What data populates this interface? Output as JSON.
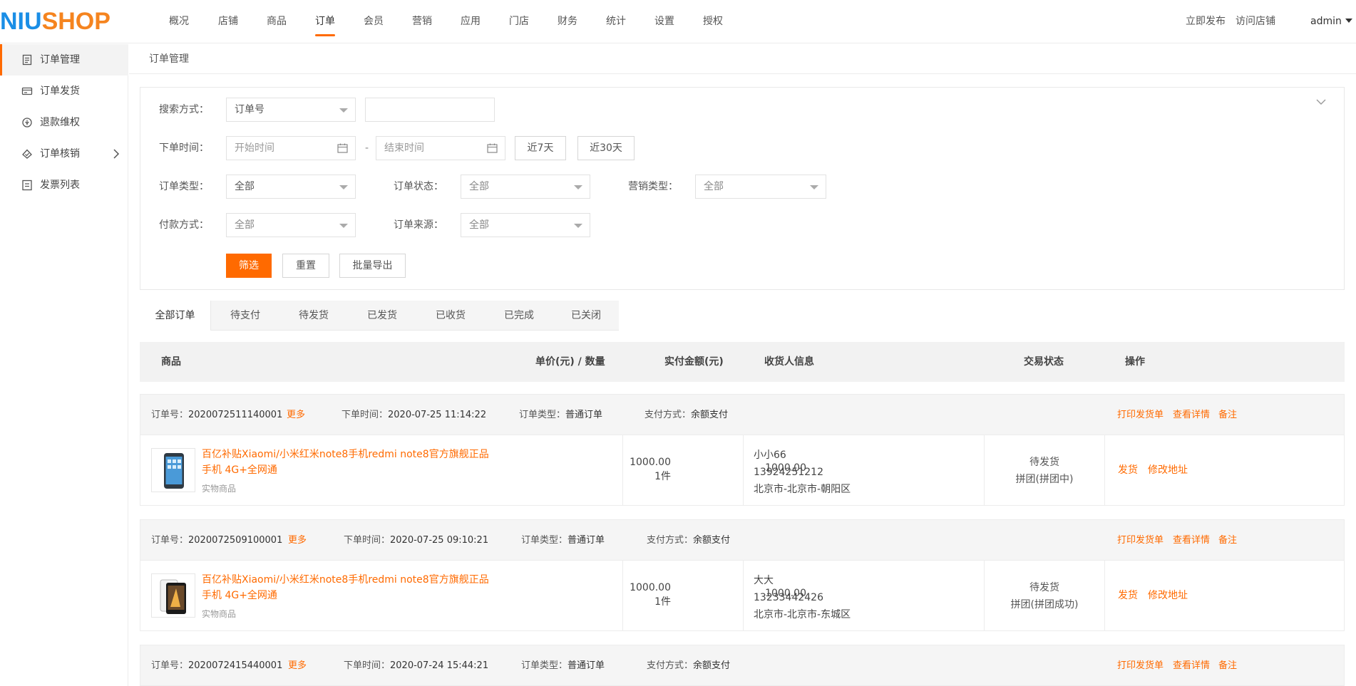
{
  "brand": {
    "logo_part1": "NIU",
    "logo_part2": "SHOP"
  },
  "nav": {
    "items": [
      "概况",
      "店铺",
      "商品",
      "订单",
      "会员",
      "营销",
      "应用",
      "门店",
      "财务",
      "统计",
      "设置",
      "授权"
    ],
    "active": "订单",
    "publish": "立即发布",
    "visit_store": "访问店铺",
    "user": "admin"
  },
  "sidebar": {
    "items": [
      {
        "label": "订单管理",
        "icon": "document-icon",
        "active": true
      },
      {
        "label": "订单发货",
        "icon": "delivery-icon",
        "active": false
      },
      {
        "label": "退款维权",
        "icon": "refund-icon",
        "active": false
      },
      {
        "label": "订单核销",
        "icon": "verify-icon",
        "active": false
      },
      {
        "label": "发票列表",
        "icon": "invoice-icon",
        "active": false
      }
    ]
  },
  "breadcrumb": "订单管理",
  "filter": {
    "search_label": "搜索方式：",
    "search_type": "订单号",
    "search_value": "",
    "time_label": "下单时间：",
    "start_placeholder": "开始时间",
    "end_placeholder": "结束时间",
    "dash": "-",
    "last7": "近7天",
    "last30": "近30天",
    "order_type_label": "订单类型：",
    "order_type": "全部",
    "order_status_label": "订单状态：",
    "order_status": "全部",
    "marketing_label": "营销类型：",
    "marketing": "全部",
    "pay_label": "付款方式：",
    "pay": "全部",
    "source_label": "订单来源：",
    "source": "全部",
    "submit": "筛选",
    "reset": "重置",
    "export": "批量导出"
  },
  "tabs": [
    "全部订单",
    "待支付",
    "待发货",
    "已发货",
    "已收货",
    "已完成",
    "已关闭"
  ],
  "table_header": {
    "goods": "商品",
    "unit_price": "单价(元) / 数量",
    "paid": "实付金额(元)",
    "receiver": "收货人信息",
    "status": "交易状态",
    "ops": "操作"
  },
  "order_labels": {
    "no": "订单号：",
    "more": "更多",
    "time": "下单时间：",
    "type": "订单类型：",
    "pay": "支付方式：",
    "print": "打印发货单",
    "detail": "查看详情",
    "remark": "备注",
    "ship": "发货",
    "edit_addr": "修改地址"
  },
  "orders": [
    {
      "no": "2020072511140001",
      "time": "2020-07-25 11:14:22",
      "type": "普通订单",
      "pay": "余额支付",
      "goods_name": "百亿补贴Xiaomi/小米红米note8手机redmi note8官方旗舰正品手机 4G+全网通",
      "goods_type": "实物商品",
      "price": "1000.00",
      "qty": "1件",
      "paid": "1000.00",
      "receiver_name": "小小66",
      "receiver_phone": "13924251212",
      "receiver_addr": "北京市-北京市-朝阳区",
      "status": "待发货",
      "sub_status": "拼团(拼团中)"
    },
    {
      "no": "2020072509100001",
      "time": "2020-07-25 09:10:21",
      "type": "普通订单",
      "pay": "余额支付",
      "goods_name": "百亿补贴Xiaomi/小米红米note8手机redmi note8官方旗舰正品手机 4G+全网通",
      "goods_type": "实物商品",
      "price": "1000.00",
      "qty": "1件",
      "paid": "1000.00",
      "receiver_name": "大大",
      "receiver_phone": "13233442426",
      "receiver_addr": "北京市-北京市-东城区",
      "status": "待发货",
      "sub_status": "拼团(拼团成功)"
    },
    {
      "no": "2020072415440001",
      "time": "2020-07-24 15:44:21",
      "type": "普通订单",
      "pay": "余额支付"
    }
  ],
  "colors": {
    "accent": "#ff6a00",
    "logo_blue": "#1a8ee6",
    "logo_orange": "#f5841f"
  }
}
